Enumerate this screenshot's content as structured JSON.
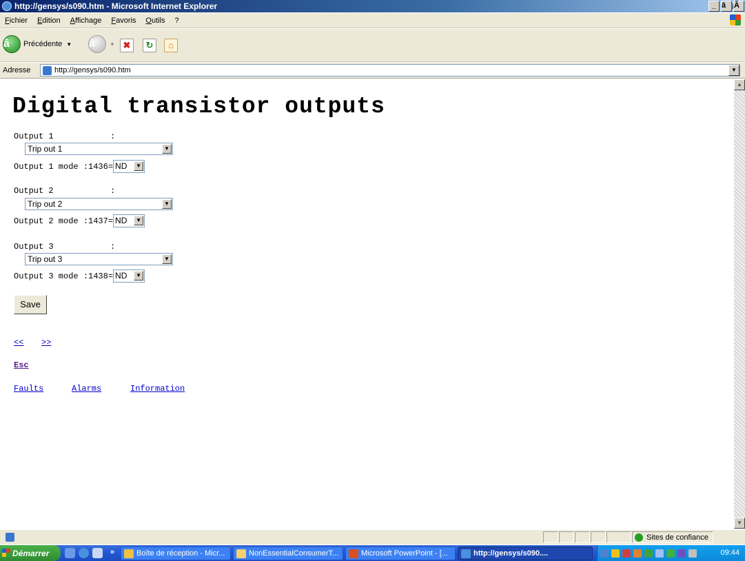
{
  "window": {
    "title": "http://gensys/s090.htm - Microsoft Internet Explorer",
    "minimize": "_",
    "maximize": "â¡",
    "close": "Ã"
  },
  "menu": {
    "items": [
      "Fichier",
      "Edition",
      "Affichage",
      "Favoris",
      "Outils",
      "?"
    ]
  },
  "toolbar": {
    "back_label": "Précédente",
    "back_arrow": "â",
    "forward_arrow": "â"
  },
  "address": {
    "label": "Adresse",
    "url": "http://gensys/s090.htm"
  },
  "page": {
    "title": "Digital transistor outputs",
    "colon": ":",
    "outputs": [
      {
        "label": "Output 1",
        "selected": "Trip out 1",
        "mode_label": "Output 1 mode :1436=",
        "mode_value": "ND"
      },
      {
        "label": "Output 2",
        "selected": "Trip out 2",
        "mode_label": "Output 2 mode :1437=",
        "mode_value": "ND"
      },
      {
        "label": "Output 3",
        "selected": "Trip out 3",
        "mode_label": "Output 3 mode :1438=",
        "mode_value": "ND"
      }
    ],
    "save_label": "Save",
    "prev_link": "<<",
    "next_link": ">>",
    "esc_link": "Esc",
    "links": [
      "Faults",
      "Alarms",
      "Information"
    ]
  },
  "status": {
    "zone": "Sites de confiance"
  },
  "taskbar": {
    "start": "Démarrer",
    "chevron": "»",
    "tasks": [
      "Boîte de réception - Micr...",
      "NonEssentialConsumerT...",
      "Microsoft PowerPoint - [...",
      "http://gensys/s090...."
    ],
    "clock": "09:44"
  },
  "colors": {
    "accent": "#0a246a",
    "link": "#0000cc",
    "visited": "#551a8b",
    "taskbar": "#245bd6"
  }
}
